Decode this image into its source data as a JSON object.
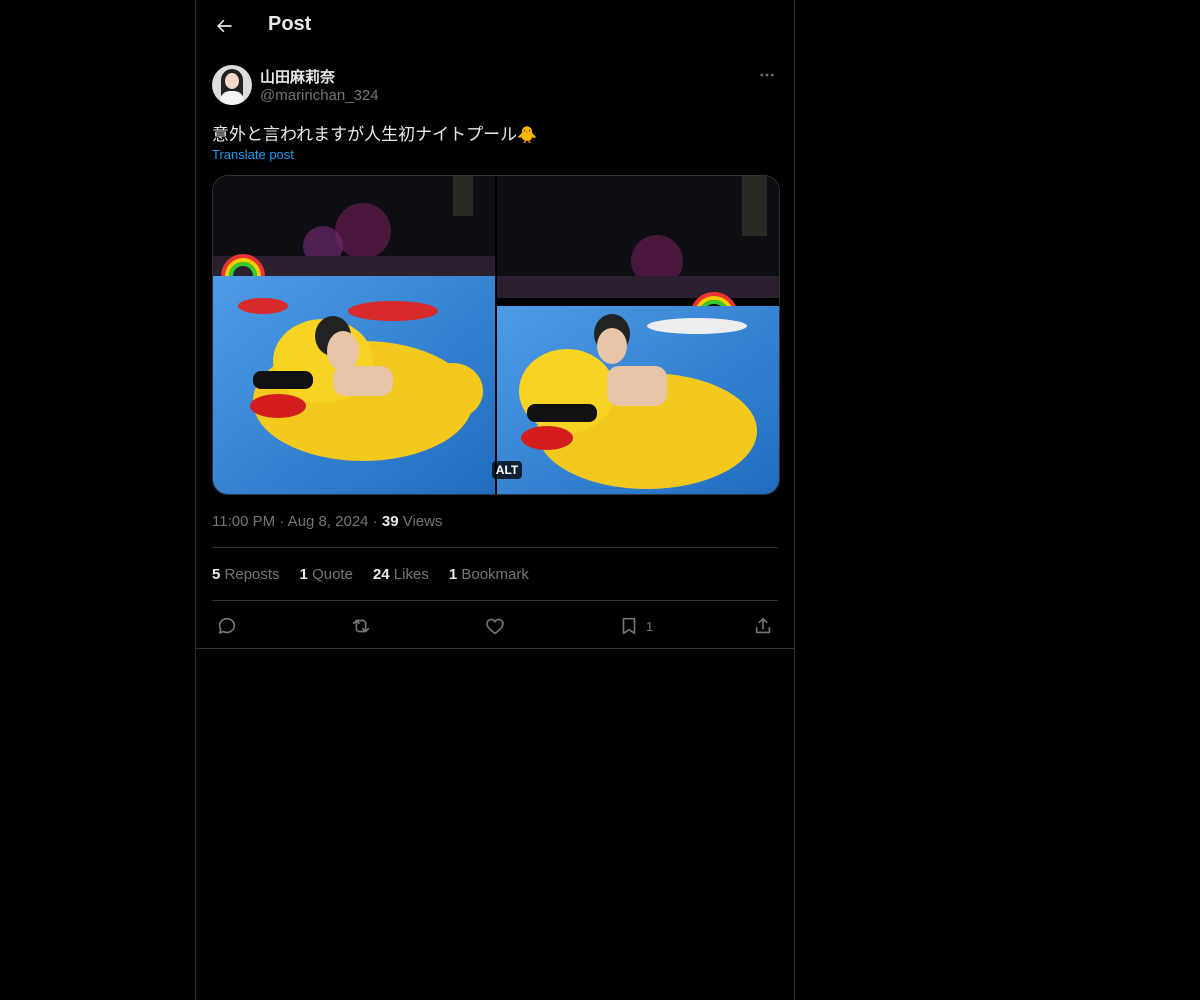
{
  "header": {
    "title": "Post"
  },
  "author": {
    "display_name": "山田麻莉奈",
    "handle": "@maririchan_324"
  },
  "post": {
    "text": "意外と言われますが人生初ナイトプール",
    "emoji": "🐥",
    "translate_label": "Translate post",
    "alt_label": "ALT",
    "time": "11:00 PM",
    "date": "Aug 8, 2024",
    "separator": "·",
    "views_count": "39",
    "views_label": "Views"
  },
  "stats": {
    "reposts_count": "5",
    "reposts_label": "Reposts",
    "quotes_count": "1",
    "quotes_label": "Quote",
    "likes_count": "24",
    "likes_label": "Likes",
    "bookmarks_count": "1",
    "bookmarks_label": "Bookmark"
  },
  "actions": {
    "bookmark_count": "1"
  },
  "icons": [
    "back-arrow-icon",
    "more-icon",
    "reply-icon",
    "repost-icon",
    "like-icon",
    "bookmark-icon",
    "share-icon"
  ],
  "colors": {
    "background": "#000000",
    "text": "#e7e9ea",
    "muted": "#71767b",
    "accent": "#1d9bf0",
    "border": "#2f3336"
  }
}
